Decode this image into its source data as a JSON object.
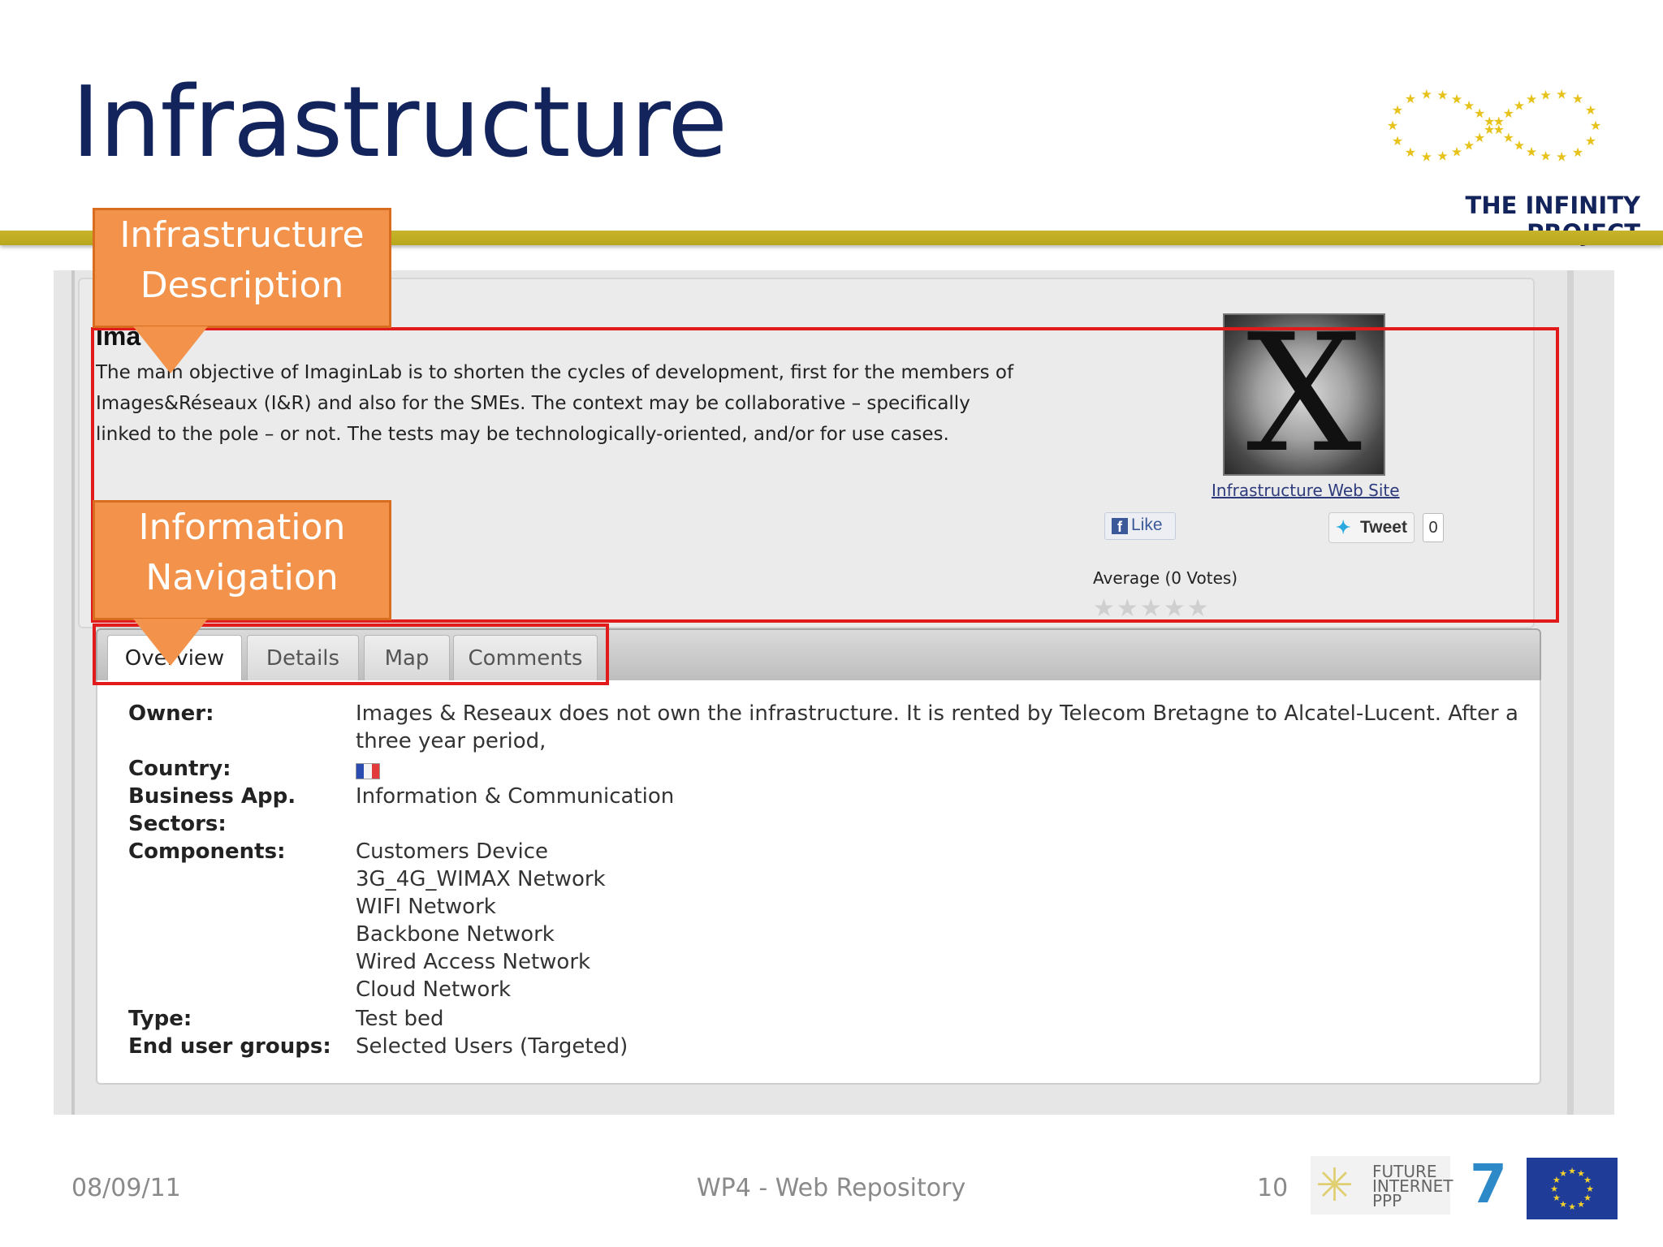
{
  "slide": {
    "title": "Infrastructure",
    "logo_text": "THE INFINITY PROJECT",
    "footer": {
      "date": "08/09/11",
      "center": "WP4 - Web Repository",
      "page": "10"
    },
    "partner_logo_text": [
      "FUTURE",
      "INTERNET",
      "PPP"
    ],
    "fp7_label": "7"
  },
  "callouts": {
    "description": [
      "Infrastructure",
      "Description"
    ],
    "navigation": [
      "Information",
      "Navigation"
    ]
  },
  "infrastructure": {
    "name_visible": "Ima        ab",
    "description": "The main objective of ImaginLab is to shorten the cycles of development, first for the members of Images&Réseaux (I&R) and also for the SMEs. The context may be collaborative – specifically linked to the pole – or not. The tests may be technologically-oriented, and/or for use cases.",
    "image_letter": "X",
    "website_link": "Infrastructure Web Site",
    "like_label": "Like",
    "tweet_label": "Tweet",
    "tweet_count": "0",
    "average_label": "Average (0 Votes)",
    "rating_stars": 0,
    "rating_max": 5
  },
  "tabs": [
    {
      "label": "Overview",
      "active": true
    },
    {
      "label": "Details",
      "active": false
    },
    {
      "label": "Map",
      "active": false
    },
    {
      "label": "Comments",
      "active": false
    }
  ],
  "overview": {
    "owner_label": "Owner:",
    "owner_value": "Images & Reseaux does not own the infrastructure. It is rented by Telecom Bretagne to Alcatel-Lucent. After a",
    "owner_value_2": "three year period,",
    "country_label": "Country:",
    "country_flag": "france-flag",
    "business_label": "Business App.",
    "sectors_label": "Sectors:",
    "business_value": "Information & Communication",
    "components_label": "Components:",
    "components": [
      "Customers Device",
      "3G_4G_WIMAX Network",
      "WIFI Network",
      "Backbone Network",
      "Wired Access Network",
      "Cloud Network"
    ],
    "type_label": "Type:",
    "type_value": "Test bed",
    "groups_label": "End user groups:",
    "groups_value": "Selected Users (Targeted)"
  },
  "colors": {
    "title": "#13235b",
    "rule": "#c7b42a",
    "callout": "#f3934b",
    "highlight": "#e11b1b"
  }
}
